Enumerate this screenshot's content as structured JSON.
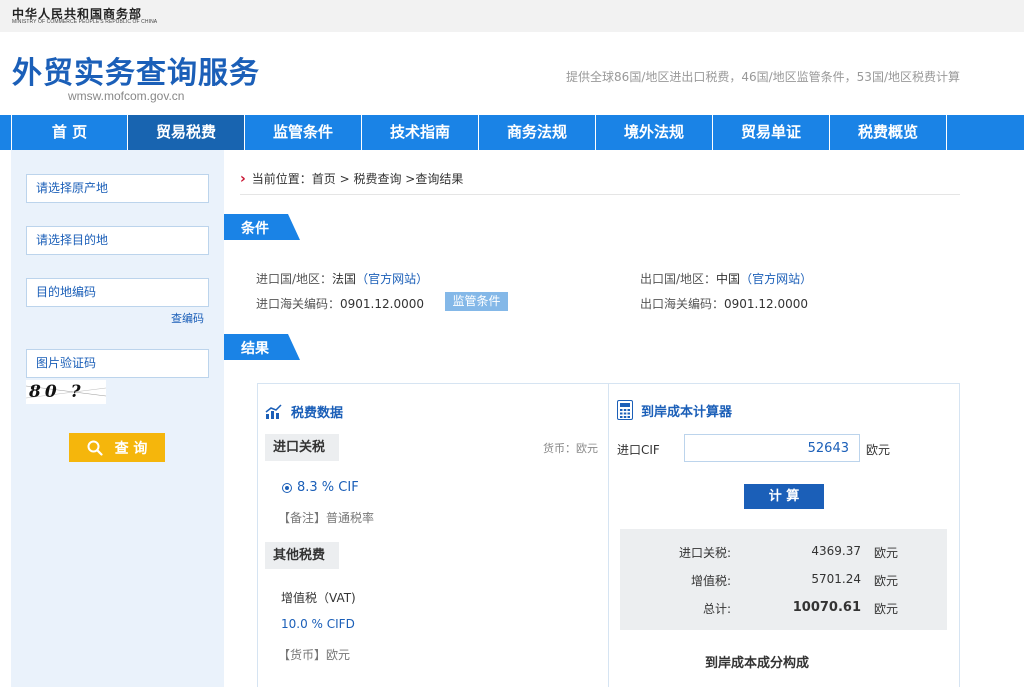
{
  "ministry": {
    "name_cn": "中华人民共和国商务部",
    "name_en": "MINISTRY OF COMMERCE PEOPLE'S REPUBLIC OF CHINA"
  },
  "header": {
    "title": "外贸实务查询服务",
    "url": "wmsw.mofcom.gov.cn",
    "tagline": "提供全球86国/地区进出口税费，46国/地区监管条件，53国/地区税费计算"
  },
  "nav": {
    "items": [
      "首 页",
      "贸易税费",
      "监管条件",
      "技术指南",
      "商务法规",
      "境外法规",
      "贸易单证",
      "税费概览"
    ],
    "active_index": 1
  },
  "sidebar": {
    "origin_placeholder": "请选择原产地",
    "destination_placeholder": "请选择目的地",
    "code_placeholder": "目的地编码",
    "code_lookup": "查编码",
    "captcha_placeholder": "图片验证码",
    "captcha_text": "80 ? 8",
    "search_label": "查 询"
  },
  "breadcrumb": "当前位置：首页 > 税费查询 >查询结果",
  "conditions": {
    "section_label": "条件",
    "import_country_label": "进口国/地区：",
    "import_country": "法国",
    "import_site": "（官方网站）",
    "export_country_label": "出口国/地区：",
    "export_country": "中国",
    "export_site": "（官方网站）",
    "import_code_label": "进口海关编码：",
    "import_code": "0901.12.0000",
    "export_code_label": "出口海关编码：",
    "export_code": "0901.12.0000",
    "supervision_chip": "监管条件"
  },
  "results": {
    "section_label": "结果",
    "tax_data": {
      "title": "税费数据",
      "import_duty_label": "进口关税",
      "currency_note": "货币：欧元",
      "rate": "8.3 % CIF",
      "remark": "【备注】普通税率",
      "other_taxes_label": "其他税费",
      "vat_label": "增值税（VAT)",
      "vat_rate": "10.0 % CIFD",
      "currency": "【货币】欧元"
    },
    "calculator": {
      "title": "到岸成本计算器",
      "cif_label": "进口CIF",
      "cif_value": "52643",
      "cif_unit": "欧元",
      "calc_button": "计 算",
      "rows": [
        {
          "label": "进口关税:",
          "value": "4369.37",
          "unit": "欧元"
        },
        {
          "label": "增值税:",
          "value": "5701.24",
          "unit": "欧元"
        },
        {
          "label": "总计:",
          "value": "10070.61",
          "unit": "欧元"
        }
      ],
      "composition_title": "到岸成本成分构成"
    }
  },
  "colors": {
    "brand_blue": "#1b5fb8",
    "nav_blue": "#1a83e6",
    "nav_active": "#1864b0",
    "search_yellow": "#f5b60c",
    "sidebar_bg": "#eaf2fb"
  },
  "icons": [
    "chart-icon",
    "calculator-icon",
    "search-icon",
    "chevron-right-icon"
  ]
}
